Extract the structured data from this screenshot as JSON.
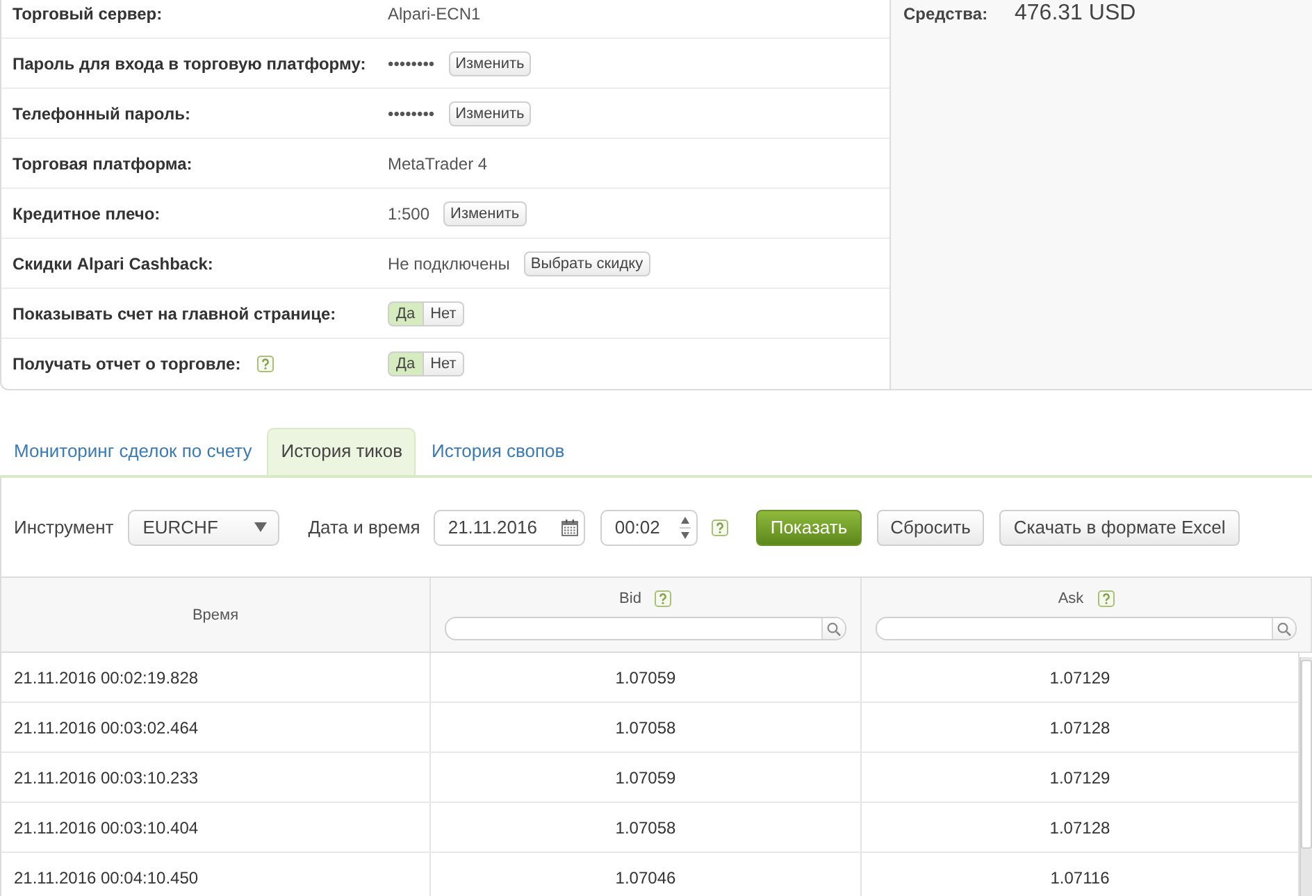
{
  "account": {
    "rows": [
      {
        "kind": "text",
        "label": "Торговый сервер:",
        "help": false,
        "value": "Alpari-ECN1"
      },
      {
        "kind": "action",
        "label": "Пароль для входа в торговую платформу:",
        "help": false,
        "value": "••••••••",
        "action": "Изменить"
      },
      {
        "kind": "action",
        "label": "Телефонный пароль:",
        "help": false,
        "value": "••••••••",
        "action": "Изменить"
      },
      {
        "kind": "text",
        "label": "Торговая платформа:",
        "help": false,
        "value": "MetaTrader 4"
      },
      {
        "kind": "action",
        "label": "Кредитное плечо:",
        "help": false,
        "value": "1:500",
        "action": "Изменить"
      },
      {
        "kind": "action",
        "label": "Скидки Alpari Cashback:",
        "help": false,
        "value": "Не подключены",
        "action": "Выбрать скидку"
      },
      {
        "kind": "toggle",
        "label": "Показывать счет на главной странице:",
        "help": false,
        "options": [
          {
            "label": "Да",
            "selected": true
          },
          {
            "label": "Нет",
            "selected": false
          }
        ]
      },
      {
        "kind": "toggle",
        "label": "Получать отчет о торговле:",
        "help": true,
        "options": [
          {
            "label": "Да",
            "selected": true
          },
          {
            "label": "Нет",
            "selected": false
          }
        ]
      }
    ]
  },
  "funds": {
    "label": "Средства:",
    "value": "476.31 USD"
  },
  "tabs": [
    {
      "label": "Мониторинг сделок по счету",
      "selected": false
    },
    {
      "label": "История тиков",
      "selected": true
    },
    {
      "label": "История свопов",
      "selected": false
    }
  ],
  "filters": {
    "instrument": {
      "label": "Инструмент",
      "value": "EURCHF"
    },
    "datetime": {
      "label": "Дата и время",
      "date": "21.11.2016",
      "time": "00:02",
      "help": true
    },
    "buttons": [
      {
        "label": "Показать",
        "kind": "primary"
      },
      {
        "label": "Сбросить",
        "kind": "default"
      },
      {
        "label": "Скачать в формате Excel",
        "kind": "default"
      }
    ]
  },
  "table": {
    "columns": [
      {
        "label": "Время",
        "help": false,
        "filter": false
      },
      {
        "label": "Bid",
        "help": true,
        "filter": true
      },
      {
        "label": "Ask",
        "help": true,
        "filter": true
      }
    ],
    "rows": [
      [
        "21.11.2016 00:02:19.828",
        "1.07059",
        "1.07129"
      ],
      [
        "21.11.2016 00:03:02.464",
        "1.07058",
        "1.07128"
      ],
      [
        "21.11.2016 00:03:10.233",
        "1.07059",
        "1.07129"
      ],
      [
        "21.11.2016 00:03:10.404",
        "1.07058",
        "1.07128"
      ],
      [
        "21.11.2016 00:04:10.450",
        "1.07046",
        "1.07116"
      ]
    ]
  }
}
